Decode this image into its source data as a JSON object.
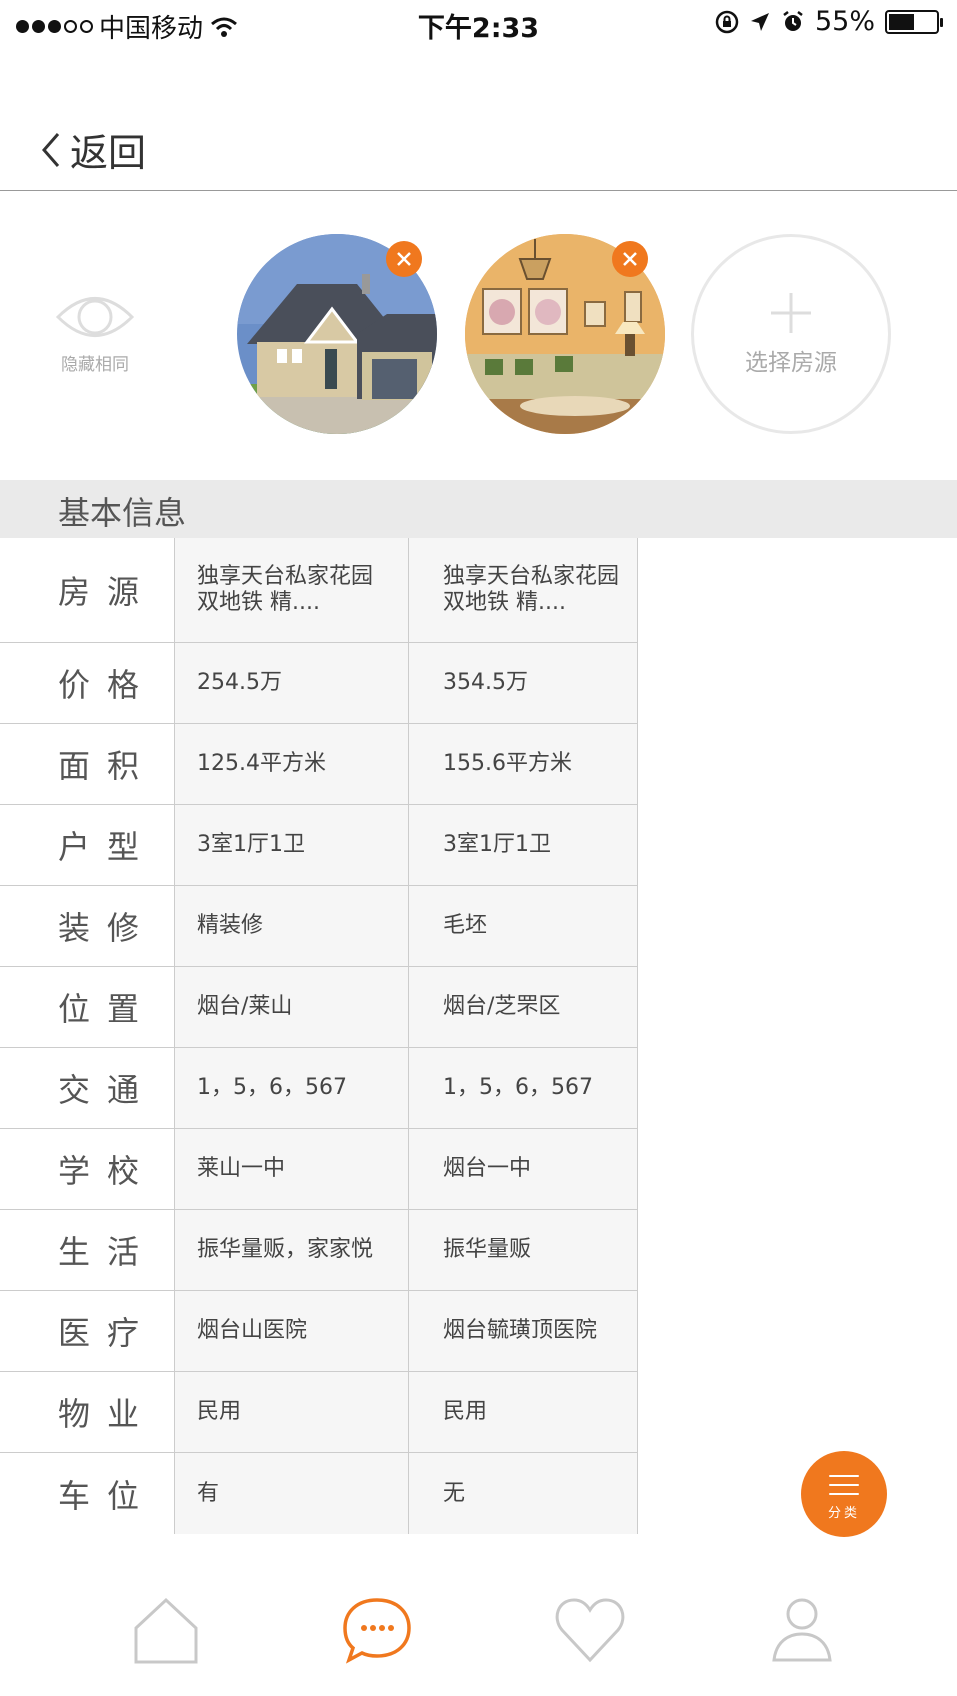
{
  "status_bar": {
    "carrier": "中国移动",
    "time": "下午2:33",
    "battery": "55%",
    "battery_level": 0.55
  },
  "nav": {
    "back_label": "返回"
  },
  "compare": {
    "hide_same_label": "隐藏相同",
    "add_house_label": "选择房源"
  },
  "section": {
    "title": "基本信息"
  },
  "table": {
    "rows": [
      {
        "label": "房源",
        "v1": "独享天台私家花园\n双地铁 精....",
        "v2": "独享天台私家花园\n双地铁 精...."
      },
      {
        "label": "价格",
        "v1": "254.5万",
        "v2": "354.5万"
      },
      {
        "label": "面积",
        "v1": "125.4平方米",
        "v2": "155.6平方米"
      },
      {
        "label": "户型",
        "v1": "3室1厅1卫",
        "v2": "3室1厅1卫"
      },
      {
        "label": "装修",
        "v1": "精装修",
        "v2": "毛坯"
      },
      {
        "label": "位置",
        "v1": "烟台/莱山",
        "v2": "烟台/芝罘区"
      },
      {
        "label": "交通",
        "v1": "1，5，6，567",
        "v2": "1，5，6，567"
      },
      {
        "label": "学校",
        "v1": "莱山一中",
        "v2": "烟台一中"
      },
      {
        "label": "生活",
        "v1": "振华量贩，家家悦",
        "v2": "振华量贩"
      },
      {
        "label": "医疗",
        "v1": "烟台山医院",
        "v2": "烟台毓璜顶医院"
      },
      {
        "label": "物业",
        "v1": "民用",
        "v2": "民用"
      },
      {
        "label": "车位",
        "v1": "有",
        "v2": "无"
      }
    ]
  },
  "fab": {
    "label": "分类"
  },
  "colors": {
    "accent": "#f0781e",
    "tab_inactive": "#c8c8c8"
  },
  "tabs": [
    {
      "icon": "home-icon"
    },
    {
      "icon": "chat-icon",
      "active": true
    },
    {
      "icon": "heart-icon"
    },
    {
      "icon": "user-icon"
    }
  ]
}
